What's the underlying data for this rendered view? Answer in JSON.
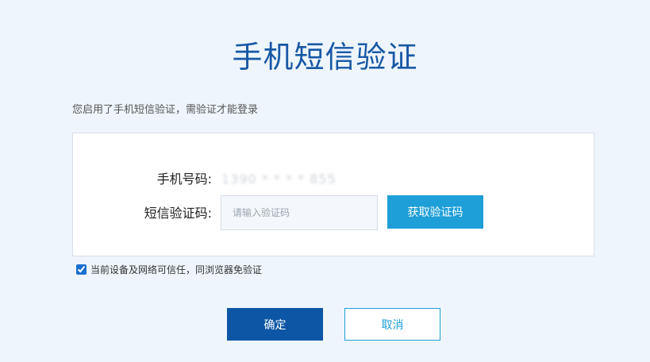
{
  "page": {
    "title": "手机短信验证",
    "notice": "您启用了手机短信验证，需验证才能登录"
  },
  "form": {
    "phone_label": "手机号码:",
    "phone_value": "1390 * * * * 855",
    "sms_label": "短信验证码:",
    "code_value": "",
    "code_placeholder": "请输入验证码",
    "get_code_label": "获取验证码"
  },
  "trust": {
    "checked": true,
    "label": "当前设备及网络可信任，同浏览器免验证"
  },
  "actions": {
    "confirm_label": "确定",
    "cancel_label": "取消"
  },
  "colors": {
    "background": "#eef5fc",
    "title": "#1858a5",
    "primary": "#0c56a5",
    "accent": "#1e9fd8"
  }
}
